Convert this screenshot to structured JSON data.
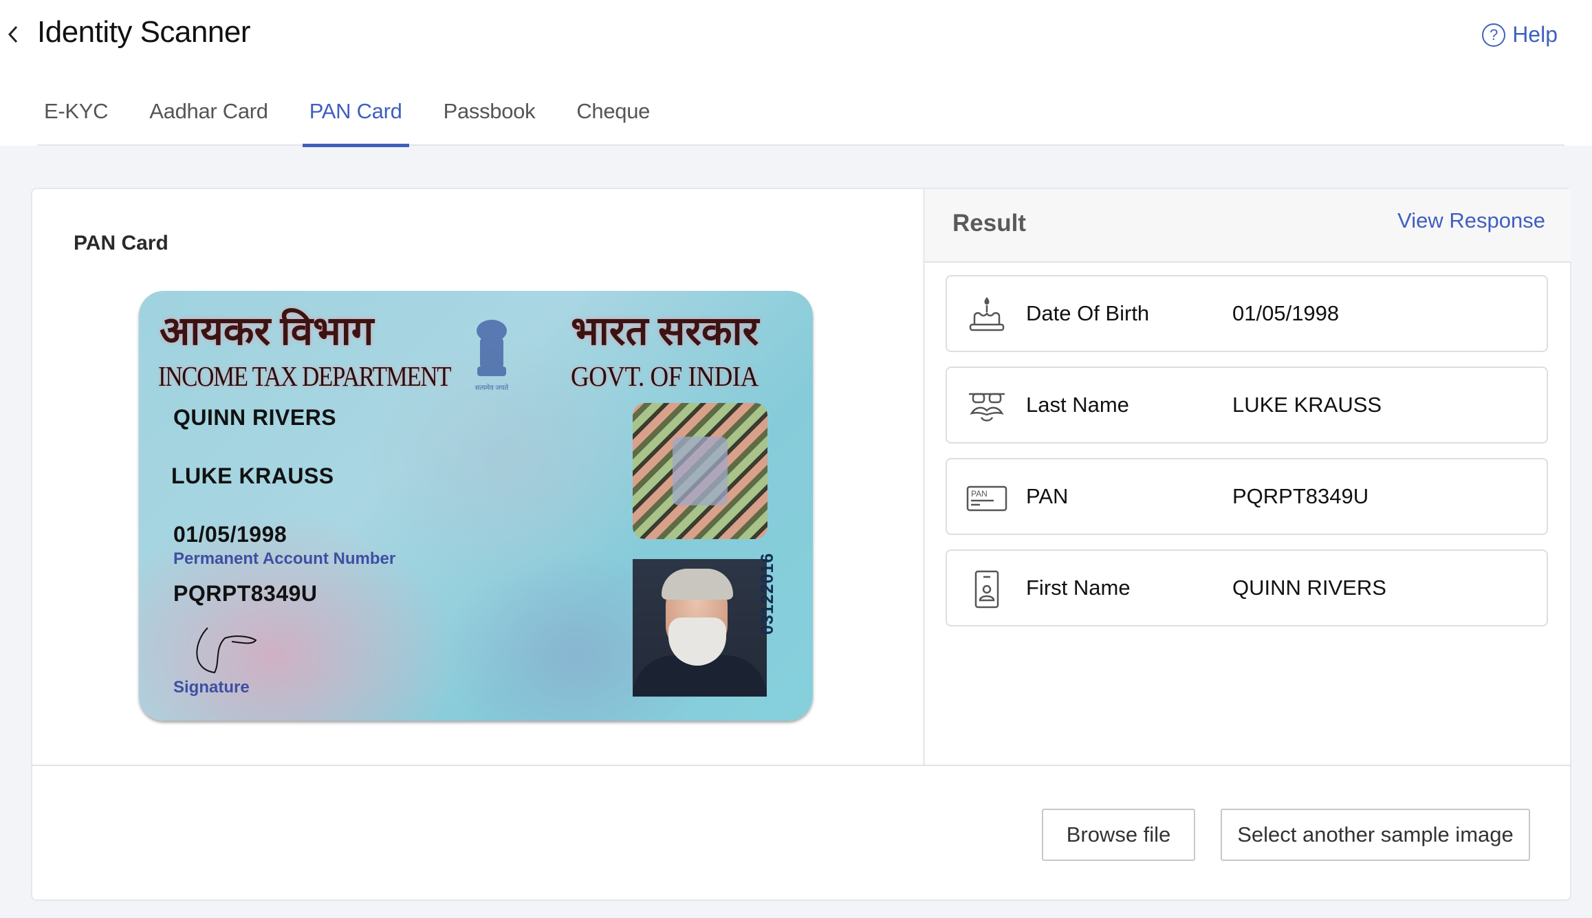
{
  "header": {
    "title": "Identity Scanner",
    "help_label": "Help",
    "help_icon": "?"
  },
  "tabs": [
    {
      "label": "E-KYC",
      "active": false
    },
    {
      "label": "Aadhar Card",
      "active": false
    },
    {
      "label": "PAN Card",
      "active": true
    },
    {
      "label": "Passbook",
      "active": false
    },
    {
      "label": "Cheque",
      "active": false
    }
  ],
  "document": {
    "section_label": "PAN Card",
    "card": {
      "hindi_left": "आयकर विभाग",
      "hindi_right": "भारत सरकार",
      "department": "INCOME TAX DEPARTMENT",
      "government": "GOVT. OF INDIA",
      "first_name": "QUINN RIVERS",
      "last_name": "LUKE KRAUSS",
      "dob": "01/05/1998",
      "pan_label": "Permanent Account Number",
      "pan_number": "PQRPT8349U",
      "signature_label": "Signature",
      "serial": "03122016",
      "emblem_caption": "सत्यमेव जयते"
    }
  },
  "result": {
    "title": "Result",
    "view_response_label": "View Response",
    "rows": [
      {
        "icon": "birthday-cake-icon",
        "label": "Date Of Birth",
        "value": "01/05/1998"
      },
      {
        "icon": "glasses-mustache-icon",
        "label": "Last Name",
        "value": "LUKE KRAUSS"
      },
      {
        "icon": "pan-card-icon",
        "label": "PAN",
        "value": "PQRPT8349U",
        "icon_text": "PAN"
      },
      {
        "icon": "id-badge-icon",
        "label": "First Name",
        "value": "QUINN RIVERS"
      }
    ]
  },
  "actions": {
    "browse_label": "Browse file",
    "sample_label": "Select another sample image"
  },
  "colors": {
    "accent": "#3f5fbf",
    "background": "#f3f4f8"
  }
}
